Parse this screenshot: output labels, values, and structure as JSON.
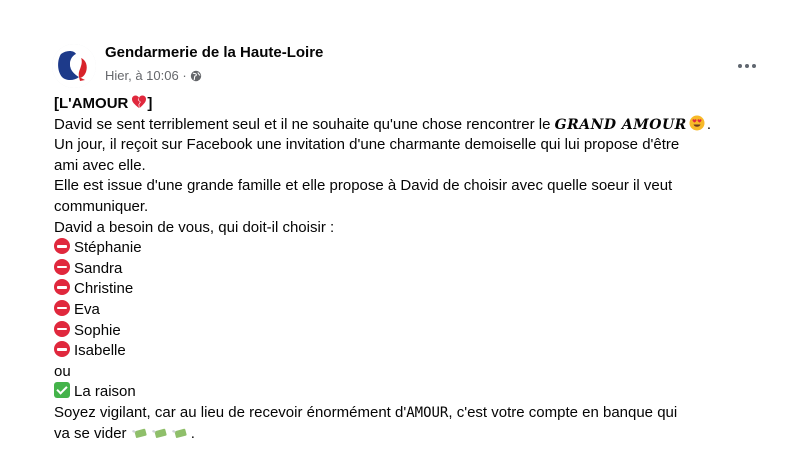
{
  "post": {
    "author": "Gendarmerie de la Haute-Loire",
    "timestamp": "Hier, à 10:06 ·",
    "privacy_icon": "globe-icon",
    "more_icon": "more-options-icon"
  },
  "content": {
    "title": "[L'AMOUR",
    "title_close": "]",
    "p1_a": "David se sent terriblement seul et il ne souhaite qu'une chose rencontrer le",
    "p1_b": "GRAND AMOUR",
    "p1_c": ".",
    "p2_a": "Un jour, il reçoit sur Facebook une invitation d'une charmante demoiselle qui lui propose d'être",
    "p2_b": "ami avec elle.",
    "p3_a": "Elle est issue d'une grande famille et elle propose à David de choisir avec quelle soeur il veut",
    "p3_b": "communiquer.",
    "p4": "David a besoin de vous, qui doit-il choisir :",
    "options": [
      "Stéphanie",
      "Sandra",
      "Christine",
      "Eva",
      "Sophie",
      "Isabelle"
    ],
    "or": "ou",
    "correct": "La raison",
    "p5_a": "Soyez vigilant, car au lieu de recevoir énormément d'",
    "p5_b": "AMOUR",
    "p5_c": ", c'est votre compte en banque qui",
    "p6_a": "va se vider",
    "p6_b": "."
  },
  "colors": {
    "accent_red": "#e0283d",
    "check_green": "#44b34a",
    "meta_gray": "#65676b"
  }
}
